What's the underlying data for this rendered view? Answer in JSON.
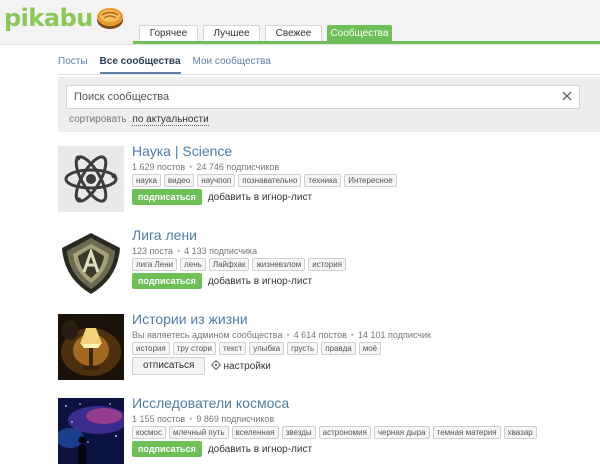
{
  "header": {
    "logo_text": "pikabu",
    "nav": [
      {
        "label": "Горячее",
        "active": false
      },
      {
        "label": "Лучшее",
        "active": false
      },
      {
        "label": "Свежее",
        "active": false
      },
      {
        "label": "Сообщества",
        "active": true
      }
    ]
  },
  "subtabs": [
    {
      "label": "Посты",
      "active": false
    },
    {
      "label": "Все сообщества",
      "active": true
    },
    {
      "label": "Мои сообщества",
      "active": false
    }
  ],
  "search": {
    "placeholder": "Поиск сообщества",
    "value": "",
    "sort_prefix": "сортировать",
    "sort_value": "по актуальности"
  },
  "communities": [
    {
      "title": "Наука | Science",
      "stats": [
        "1 629 постов",
        "24 746 подписчиков"
      ],
      "tags": [
        "наука",
        "видео",
        "научпоп",
        "познавательно",
        "техника",
        "Интересное"
      ],
      "subscribed": false,
      "primary_action": "подписаться",
      "secondary_action": "добавить в игнор-лист"
    },
    {
      "title": "Лига лени",
      "stats": [
        "123 поста",
        "4 133 подписчика"
      ],
      "tags": [
        "лига Лени",
        "лень",
        "Лайфхак",
        "жизневзлом",
        "история"
      ],
      "subscribed": false,
      "primary_action": "подписаться",
      "secondary_action": "добавить в игнор-лист"
    },
    {
      "title": "Истории из жизни",
      "stats": [
        "Вы являетесь админом сообщества",
        "4 614 постов",
        "14 101 подписчик"
      ],
      "tags": [
        "история",
        "тру стори",
        "текст",
        "улыбка",
        "грусть",
        "правда",
        "моё"
      ],
      "subscribed": true,
      "primary_action": "отписаться",
      "secondary_action": "настройки"
    },
    {
      "title": "Исследователи космоса",
      "stats": [
        "1 155 постов",
        "9 869 подписчиков"
      ],
      "tags": [
        "космос",
        "млечный путь",
        "вселенная",
        "звезды",
        "астрономия",
        "черная дыра",
        "темная материя",
        "хвазар"
      ],
      "subscribed": false,
      "primary_action": "подписаться",
      "secondary_action": "добавить в игнор-лист"
    }
  ],
  "colors": {
    "accent_green": "#6ebf58",
    "link_blue": "#4f7ca8",
    "header_bg": "#f3f3f3"
  },
  "icons": {
    "search_clear": "close-icon",
    "settings": "gear-icon"
  }
}
